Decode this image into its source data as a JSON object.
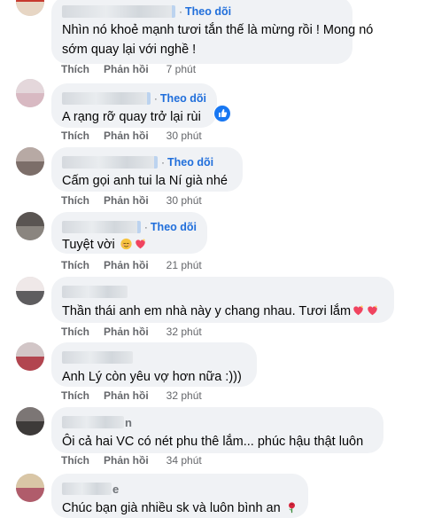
{
  "follow_label": "Theo dõi",
  "like_label": "Thích",
  "reply_label": "Phản hồi",
  "comments": [
    {
      "name_visible": "",
      "text": "Nhìn nó khoẻ mạnh tươi tắn thế là mừng rồi ! Mong nó",
      "text2": "sớm quay lại với nghề !",
      "time": "7 phút",
      "avatar": "avatar-1"
    },
    {
      "name_visible": "",
      "text": "A rạng rỡ quay trở lại rùi",
      "time": "30 phút",
      "avatar": "avatar-2",
      "has_like_reaction": true
    },
    {
      "name_visible": "",
      "text": "Cấm gọi anh tui la Ní già nhé",
      "time": "30 phút",
      "avatar": "avatar-3"
    },
    {
      "name_visible": "",
      "text": "Tuyệt vời",
      "time": "21 phút",
      "avatar": "avatar-4",
      "emojis": [
        "relieved-face",
        "sparkling-heart"
      ]
    },
    {
      "name_visible": "",
      "text": "Thần thái anh em nhà này y chang nhau. Tươi lắm",
      "time": "32 phút",
      "avatar": "avatar-5",
      "emojis": [
        "sparkling-heart",
        "sparkling-heart"
      ]
    },
    {
      "name_visible": "",
      "text": "Anh Lý còn yêu vợ hơn nữa :)))",
      "time": "32 phút",
      "avatar": "avatar-6"
    },
    {
      "name_visible": "n",
      "text": "Ôi cả hai VC có nét phu thê lắm... phúc hậu thật luôn",
      "time": "34 phút",
      "avatar": "avatar-7"
    },
    {
      "name_visible": "e",
      "text": "Chúc bạn già nhiều sk và luôn bình an",
      "time": "34 phút",
      "avatar": "avatar-8",
      "emojis": [
        "rose"
      ]
    }
  ],
  "colors": {
    "follow": "#216fdb",
    "bubble": "#f0f2f5",
    "meta": "#65676b"
  }
}
